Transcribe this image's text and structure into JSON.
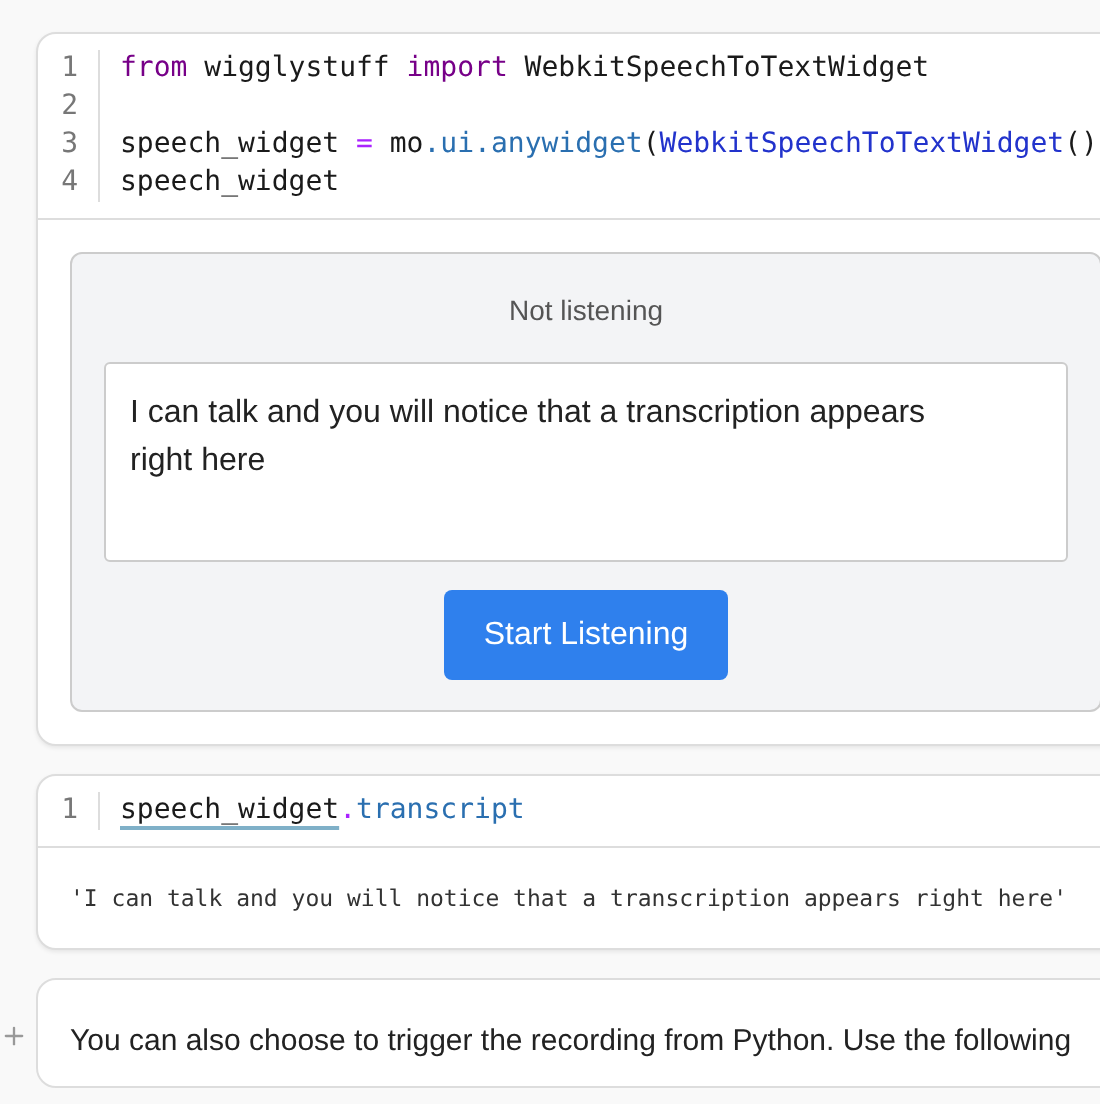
{
  "cells": [
    {
      "kind": "code",
      "lines": [
        {
          "number": "1",
          "tokens": [
            {
              "text": "from",
              "kind": "keyword"
            },
            {
              "text": " wigglystuff ",
              "kind": "plain"
            },
            {
              "text": "import",
              "kind": "keyword"
            },
            {
              "text": " WebkitSpeechToTextWidget",
              "kind": "plain"
            }
          ]
        },
        {
          "number": "2"
        },
        {
          "number": "3",
          "tokens": [
            {
              "text": "speech_widget ",
              "kind": "plain"
            },
            {
              "text": "=",
              "kind": "operator"
            },
            {
              "text": " mo",
              "kind": "plain"
            },
            {
              "text": ".ui.anywidget",
              "kind": "attribute"
            },
            {
              "text": "(",
              "kind": "plain"
            },
            {
              "text": "WebkitSpeechToTextWidget",
              "kind": "call"
            },
            {
              "text": "()",
              "kind": "plain"
            }
          ]
        },
        {
          "number": "4",
          "tokens": [
            {
              "text": "speech_widget",
              "kind": "plain"
            }
          ]
        }
      ],
      "widget": {
        "status": "Not listening",
        "transcript": "I can talk and you will notice that a transcription appears right here",
        "button": "Start Listening"
      }
    },
    {
      "kind": "code",
      "lines": [
        {
          "number": "1",
          "tokens": [
            {
              "text": "speech_widget",
              "kind": "underlined"
            },
            {
              "text": ".",
              "kind": "operator"
            },
            {
              "text": "transcript",
              "kind": "attribute"
            }
          ]
        }
      ],
      "output": "'I can talk and you will notice that a transcription appears right here'"
    },
    {
      "kind": "markdown",
      "text": "You can also choose to trigger the recording from Python. Use the following"
    }
  ]
}
